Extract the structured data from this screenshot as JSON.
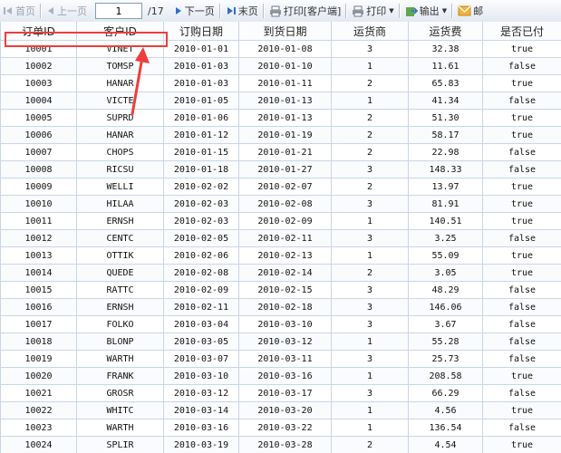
{
  "toolbar": {
    "first_label": "首页",
    "prev_label": "上一页",
    "page_value": "1",
    "page_total": "/17",
    "next_label": "下一页",
    "last_label": "末页",
    "print_client_label": "打印[客户端]",
    "print_label": "打印",
    "export_label": "输出",
    "mail_label": "邮"
  },
  "table": {
    "headers": [
      "订单ID",
      "客户ID",
      "订购日期",
      "到货日期",
      "运货商",
      "运货费",
      "是否已付"
    ],
    "rows": [
      [
        "10001",
        "VINET",
        "2010-01-01",
        "2010-01-08",
        "3",
        "32.38",
        "true"
      ],
      [
        "10002",
        "TOMSP",
        "2010-01-03",
        "2010-01-10",
        "1",
        "11.61",
        "false"
      ],
      [
        "10003",
        "HANAR",
        "2010-01-03",
        "2010-01-11",
        "2",
        "65.83",
        "true"
      ],
      [
        "10004",
        "VICTE",
        "2010-01-05",
        "2010-01-13",
        "1",
        "41.34",
        "false"
      ],
      [
        "10005",
        "SUPRD",
        "2010-01-06",
        "2010-01-13",
        "2",
        "51.30",
        "true"
      ],
      [
        "10006",
        "HANAR",
        "2010-01-12",
        "2010-01-19",
        "2",
        "58.17",
        "true"
      ],
      [
        "10007",
        "CHOPS",
        "2010-01-15",
        "2010-01-21",
        "2",
        "22.98",
        "false"
      ],
      [
        "10008",
        "RICSU",
        "2010-01-18",
        "2010-01-27",
        "3",
        "148.33",
        "false"
      ],
      [
        "10009",
        "WELLI",
        "2010-02-02",
        "2010-02-07",
        "2",
        "13.97",
        "true"
      ],
      [
        "10010",
        "HILAA",
        "2010-02-03",
        "2010-02-08",
        "3",
        "81.91",
        "true"
      ],
      [
        "10011",
        "ERNSH",
        "2010-02-03",
        "2010-02-09",
        "1",
        "140.51",
        "true"
      ],
      [
        "10012",
        "CENTC",
        "2010-02-05",
        "2010-02-11",
        "3",
        "3.25",
        "false"
      ],
      [
        "10013",
        "OTTIK",
        "2010-02-06",
        "2010-02-13",
        "1",
        "55.09",
        "true"
      ],
      [
        "10014",
        "QUEDE",
        "2010-02-08",
        "2010-02-14",
        "2",
        "3.05",
        "true"
      ],
      [
        "10015",
        "RATTC",
        "2010-02-09",
        "2010-02-15",
        "3",
        "48.29",
        "false"
      ],
      [
        "10016",
        "ERNSH",
        "2010-02-11",
        "2010-02-18",
        "3",
        "146.06",
        "false"
      ],
      [
        "10017",
        "FOLKO",
        "2010-03-04",
        "2010-03-10",
        "3",
        "3.67",
        "false"
      ],
      [
        "10018",
        "BLONP",
        "2010-03-05",
        "2010-03-12",
        "1",
        "55.28",
        "false"
      ],
      [
        "10019",
        "WARTH",
        "2010-03-07",
        "2010-03-11",
        "3",
        "25.73",
        "false"
      ],
      [
        "10020",
        "FRANK",
        "2010-03-10",
        "2010-03-16",
        "1",
        "208.58",
        "true"
      ],
      [
        "10021",
        "GROSR",
        "2010-03-12",
        "2010-03-17",
        "3",
        "66.29",
        "false"
      ],
      [
        "10022",
        "WHITC",
        "2010-03-14",
        "2010-03-20",
        "1",
        "4.56",
        "true"
      ],
      [
        "10023",
        "WARTH",
        "2010-03-16",
        "2010-03-22",
        "1",
        "136.54",
        "false"
      ],
      [
        "10024",
        "SPLIR",
        "2010-03-19",
        "2010-03-28",
        "2",
        "4.54",
        "true"
      ]
    ]
  },
  "colors": {
    "highlight": "#ee3d3d",
    "grid_border": "#c8d6e6",
    "toolbar_bg": "#e3e9f2"
  }
}
